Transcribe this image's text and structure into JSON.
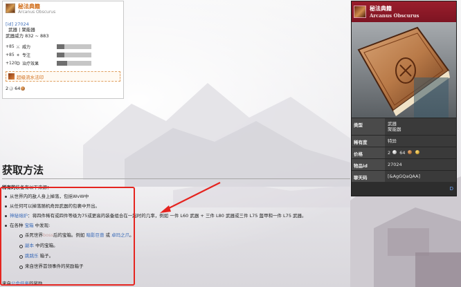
{
  "tooltip": {
    "title": "秘法典籍",
    "subtitle": "Arcanus Obscurus",
    "id_text": "[id] 27024",
    "weapon_type": "武器 | 聚能器",
    "weapon_strength": "武器威力 832 ~ 883",
    "stats": [
      {
        "value": "+85",
        "name": "威力",
        "fill": 0.22
      },
      {
        "value": "+85",
        "name": "专注",
        "fill": 0.22
      },
      {
        "value": "+120",
        "name": "治疗效果",
        "fill": 0.3
      }
    ],
    "upgrade": "超级流水法印",
    "price_silver": "2",
    "price_copper": "64"
  },
  "infobox": {
    "title": "秘法典籍",
    "subtitle": "Arcanus Obscurus",
    "rows": [
      {
        "label": "类型",
        "value_line1": "武器",
        "value_line2": "聚能器"
      },
      {
        "label": "稀有度",
        "value": "特异"
      },
      {
        "label": "价格",
        "value_silver": "2",
        "value_copper": "64"
      },
      {
        "label": "物品id",
        "value": "27024"
      },
      {
        "label": "聊天码",
        "value": "[&AgGQaQAA]"
      }
    ],
    "footer_link": "D"
  },
  "section": {
    "title": "获取方法",
    "intro_bold": "稀有的",
    "intro_rest": "装备有以下来源："
  },
  "acquisition": [
    {
      "text": "从世界内的敌人身上掉落，包括WvW中"
    },
    {
      "text": "从任何可以掉落随机奇异武器的包裹中开出。"
    },
    {
      "link": "神秘熔炉",
      "text": "：将四件稀有或四件等级为75或更高的装备组合在一起时的几率，例如 一件 L60 武器 + 三件 L80 武器或三件 L75 盔甲和一件 L75 武器。"
    },
    {
      "prefix": "在各种 ",
      "link": "宝箱",
      "suffix": " 中发现:"
    }
  ],
  "chests": [
    {
      "prefix": "杀死世界",
      "faint": "boss",
      "mid": "后的宝箱。例如 ",
      "link1": "暗影巨兽",
      "joiner": " 或 ",
      "link2": "卓玛之爪",
      "end": "。"
    },
    {
      "link": "副本",
      "suffix": " 中的宝箱。"
    },
    {
      "link": "跳跳乐",
      "suffix": " 箱子。"
    },
    {
      "text": "来自世界首领事件的奖励箱子"
    }
  ],
  "outro": {
    "prefix": "来自",
    "link": "公会任务",
    "suffix": "的奖励"
  }
}
